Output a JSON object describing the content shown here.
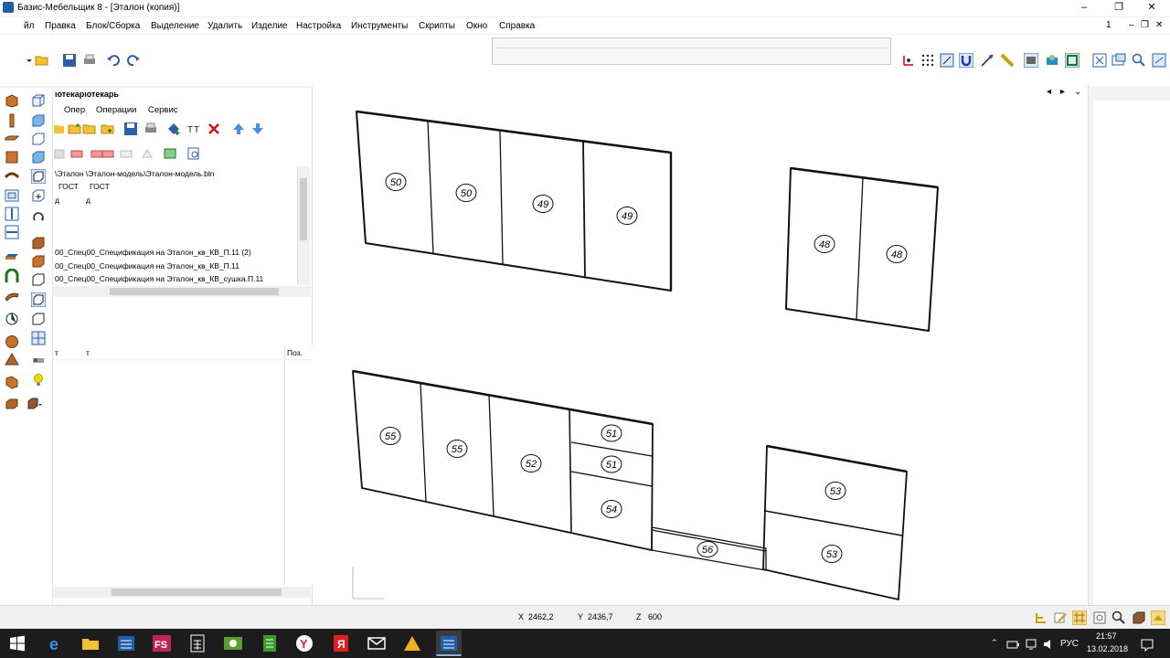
{
  "window": {
    "title": "Базис-Мебельщик 8 - [Эталон (копия)]",
    "minimize": "–",
    "maximize": "❐",
    "close": "✕"
  },
  "menu": {
    "items": [
      "йл",
      "Правка",
      "Блок/Сборка",
      "Выделение",
      "Удалить",
      "Изделие",
      "Настройка",
      "Инструменты",
      "Скрипты",
      "Окно",
      "Справка"
    ],
    "mdi_number": "1",
    "mdi_min": "–",
    "mdi_max": "❐",
    "mdi_close": "✕"
  },
  "panel": {
    "title": "ıотекарıотекарь",
    "menu": [
      "Опер",
      "Операции",
      "Сервис"
    ],
    "path": "\\Эталон \\Эталон-модель\\Эталон-модель.bln",
    "row_gost_1": "ГОСТ",
    "row_gost_2": "ГОСТ",
    "row_d_1": "д",
    "row_d_2": "д",
    "files": [
      "00_Спец00_Спецификация на Эталон_кв_КВ_П.11 (2)",
      "00_Спец00_Спецификация на Эталон_кв_КВ_П.11",
      "00_Спец00_Спецификация на Эталон_кв_КВ_сушка.П.11"
    ],
    "lower_col1": "т",
    "lower_col2": "т",
    "lower_col3": "Поз."
  },
  "drawing": {
    "part_labels": [
      "50",
      "50",
      "49",
      "49",
      "48",
      "48",
      "55",
      "55",
      "52",
      "51",
      "51",
      "54",
      "56",
      "53",
      "53"
    ]
  },
  "status": {
    "x_label": "X",
    "x_value": "2462,2",
    "y_label": "Y",
    "y_value": "2436,7",
    "z_label": "Z",
    "z_value": "600"
  },
  "taskbar": {
    "time": "21:57",
    "date": "13.02.2018",
    "lang": "РУС"
  },
  "colors": {
    "accent": "#1e5fa8",
    "taskbar": "#1c1c1c"
  }
}
